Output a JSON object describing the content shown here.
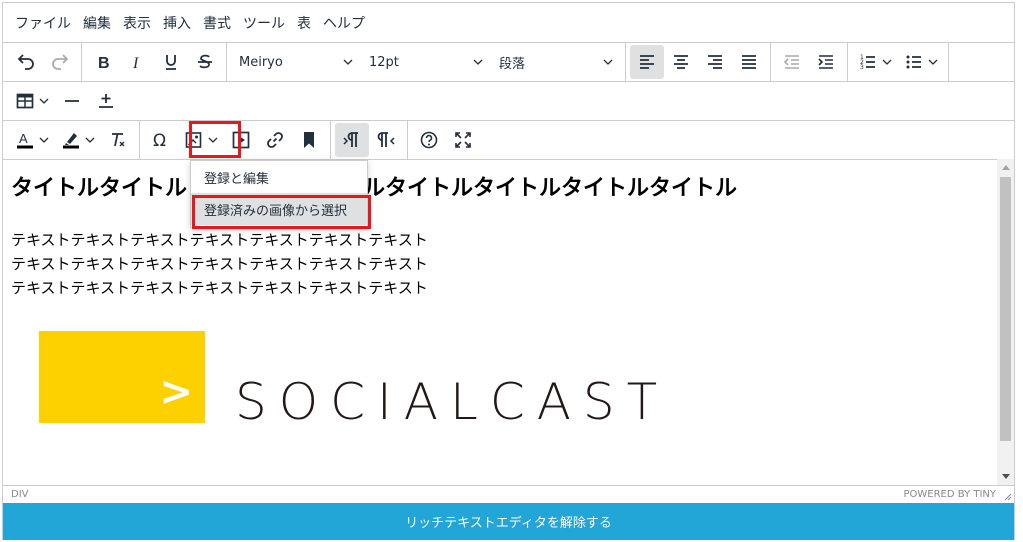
{
  "menubar": {
    "items": [
      "ファイル",
      "編集",
      "表示",
      "挿入",
      "書式",
      "ツール",
      "表",
      "ヘルプ"
    ]
  },
  "toolbar": {
    "font_family": "Meiryo",
    "font_size": "12pt",
    "block_format": "段落"
  },
  "icons": {
    "undo": "undo-icon",
    "redo": "redo-icon",
    "bold": "bold-icon",
    "italic": "italic-icon",
    "underline": "underline-icon",
    "strikethrough": "strikethrough-icon",
    "align_left": "align-left-icon",
    "align_center": "align-center-icon",
    "align_right": "align-right-icon",
    "justify": "justify-icon",
    "outdent": "outdent-icon",
    "indent": "indent-icon",
    "numbered_list": "numbered-list-icon",
    "bullet_list": "bullet-list-icon",
    "table": "table-icon",
    "horizontal_rule": "horizontal-rule-icon",
    "insert_below": "insert-below-icon",
    "text_color": "text-color-icon",
    "highlight": "highlight-icon",
    "clear_format": "clear-format-icon",
    "special_char": "omega-icon",
    "image": "image-icon",
    "media": "media-icon",
    "link": "link-icon",
    "bookmark": "bookmark-icon",
    "ltr": "ltr-icon",
    "rtl": "rtl-icon",
    "help": "help-icon",
    "fullscreen": "fullscreen-icon"
  },
  "image_menu": {
    "items": [
      "登録と編集",
      "登録済みの画像から選択"
    ]
  },
  "content": {
    "heading_left": "タイトルタイトル",
    "heading_right": "ルタイトルタイトルタイトルタイトル",
    "paragraph": [
      "テキストテキストテキストテキストテキストテキストテキスト",
      "テキストテキストテキストテキストテキストテキストテキスト",
      "テキストテキストテキストテキストテキストテキストテキスト"
    ],
    "logo_mark": ">",
    "logo_text": "SOCIALCAST"
  },
  "statusbar": {
    "path": "DIV",
    "branding": "POWERED BY TINY"
  },
  "bottom_button": "リッチテキストエディタを解除する",
  "colors": {
    "accent": "#22a5d7",
    "highlight": "#e8171c",
    "logo_yellow": "#fdd000"
  }
}
